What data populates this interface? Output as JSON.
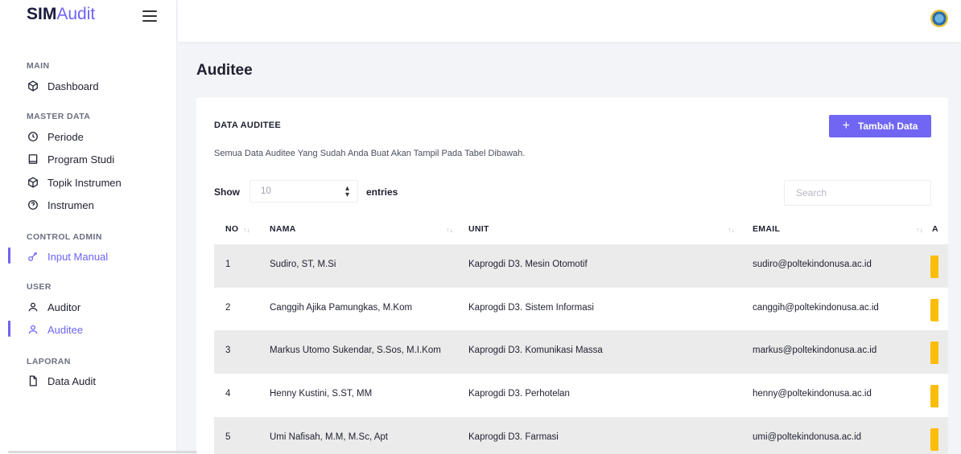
{
  "brand": {
    "bold": "SIM",
    "light": "Audit"
  },
  "sidebar": {
    "sections": [
      {
        "label": "MAIN"
      },
      {
        "label": "MASTER DATA"
      },
      {
        "label": "CONTROL ADMIN"
      },
      {
        "label": "USER"
      },
      {
        "label": "LAPORAN"
      }
    ],
    "items": [
      {
        "label": "Dashboard",
        "icon": "cube-icon"
      },
      {
        "label": "Periode",
        "icon": "clock-icon"
      },
      {
        "label": "Program Studi",
        "icon": "book-icon"
      },
      {
        "label": "Topik Instrumen",
        "icon": "cube-icon"
      },
      {
        "label": "Instrumen",
        "icon": "help-circle-icon"
      },
      {
        "label": "Input Manual",
        "icon": "key-icon",
        "active": true
      },
      {
        "label": "Auditor",
        "icon": "user-icon"
      },
      {
        "label": "Auditee",
        "icon": "user-icon",
        "active": true
      },
      {
        "label": "Data Audit",
        "icon": "file-icon"
      }
    ]
  },
  "page": {
    "title": "Auditee"
  },
  "card": {
    "title": "DATA AUDITEE",
    "description": "Semua Data Auditee Yang Sudah Anda Buat Akan Tampil Pada Tabel Dibawah.",
    "add_button": "Tambah Data",
    "show_label": "Show",
    "entries_value": "10",
    "entries_label": "entries",
    "search_placeholder": "Search"
  },
  "table": {
    "columns": [
      "NO",
      "NAMA",
      "UNIT",
      "EMAIL",
      "A"
    ],
    "rows": [
      {
        "no": "1",
        "nama": "Sudiro, ST, M.Si",
        "unit": "Kaprogdi D3. Mesin Otomotif",
        "email": "sudiro@poltekindonusa.ac.id"
      },
      {
        "no": "2",
        "nama": "Canggih Ajika Pamungkas, M.Kom",
        "unit": "Kaprogdi D3. Sistem Informasi",
        "email": "canggih@poltekindonusa.ac.id"
      },
      {
        "no": "3",
        "nama": "Markus Utomo Sukendar, S.Sos, M.I.Kom",
        "unit": "Kaprogdi D3. Komunikasi Massa",
        "email": "markus@poltekindonusa.ac.id"
      },
      {
        "no": "4",
        "nama": "Henny Kustini, S.ST, MM",
        "unit": "Kaprogdi D3. Perhotelan",
        "email": "henny@poltekindonusa.ac.id"
      },
      {
        "no": "5",
        "nama": "Umi Nafisah, M.M, M.Sc, Apt",
        "unit": "Kaprogdi D3. Farmasi",
        "email": "umi@poltekindonusa.ac.id"
      }
    ]
  },
  "colors": {
    "accent": "#7066f3",
    "warning": "#fbbd08",
    "row_stripe": "#ebebeb"
  }
}
